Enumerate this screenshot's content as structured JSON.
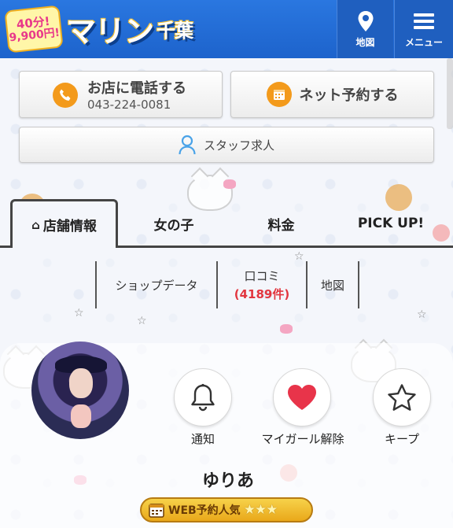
{
  "header": {
    "badge_line1": "40分!",
    "badge_line2": "9,900円!",
    "logo_main": "マリン",
    "logo_sub": "千葉",
    "map_label": "地図",
    "menu_label": "メニュー"
  },
  "actions": {
    "call_label": "お店に電話する",
    "call_number": "043-224-0081",
    "reserve_label": "ネット予約する",
    "staff_label": "スタッフ求人"
  },
  "tabs": [
    {
      "label": "店舗情報",
      "active": true
    },
    {
      "label": "女の子",
      "active": false
    },
    {
      "label": "料金",
      "active": false
    },
    {
      "label": "PICK UP!",
      "active": false
    }
  ],
  "subnav": {
    "shop_data": "ショップデータ",
    "reviews": "口コミ",
    "review_count": "(4189件)",
    "map": "地図"
  },
  "profile": {
    "name": "ゆりあ",
    "actions": {
      "notify": "通知",
      "mygirl": "マイガール解除",
      "keep": "キープ"
    },
    "badge_label": "WEB予約人気",
    "badge_stars": "★★★",
    "rating": 3
  },
  "colors": {
    "header_blue": "#1d63cc",
    "accent_orange": "#f39a1b",
    "heart_red": "#e8344a",
    "review_red": "#e2363f",
    "badge_gold": "#e9a81a"
  },
  "icons": {
    "map": "map-pin-icon",
    "menu": "hamburger-menu-icon",
    "call": "phone-icon",
    "reserve": "calendar-icon",
    "staff": "person-icon",
    "tab_home": "home-icon",
    "notify": "bell-icon",
    "mygirl": "heart-icon",
    "keep": "star-icon"
  }
}
